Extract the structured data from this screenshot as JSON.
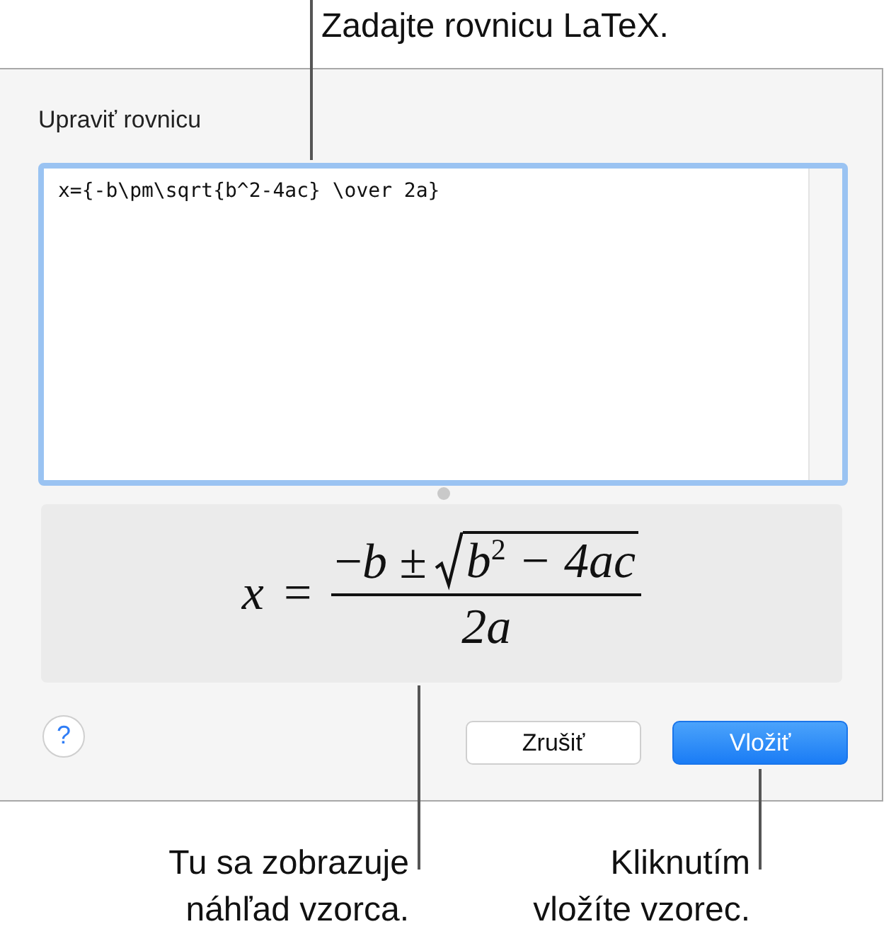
{
  "callouts": [
    {
      "kind": "top",
      "lines": [
        "Zadajte rovnicu LaTeX."
      ]
    },
    {
      "kind": "preview",
      "lines": [
        "Tu sa zobrazuje",
        "náhľad vzorca."
      ]
    },
    {
      "kind": "insert",
      "lines": [
        "Kliknutím",
        "vložíte vzorec."
      ]
    }
  ],
  "dialog": {
    "title": "Upraviť rovnicu",
    "latex": {
      "value": "x={-b\\pm\\sqrt{b^2-4ac} \\over 2a}",
      "focused": true
    },
    "preview": {
      "lhs": "x",
      "relation": "=",
      "numerator_prefix": "−*b* ±",
      "radicand": "b$^{2}$ − 4ac",
      "denominator": "2a"
    },
    "help": "?",
    "buttons": [
      {
        "label": "Zrušiť",
        "kind": "secondary"
      },
      {
        "label": "Vložiť",
        "kind": "primary"
      }
    ]
  }
}
